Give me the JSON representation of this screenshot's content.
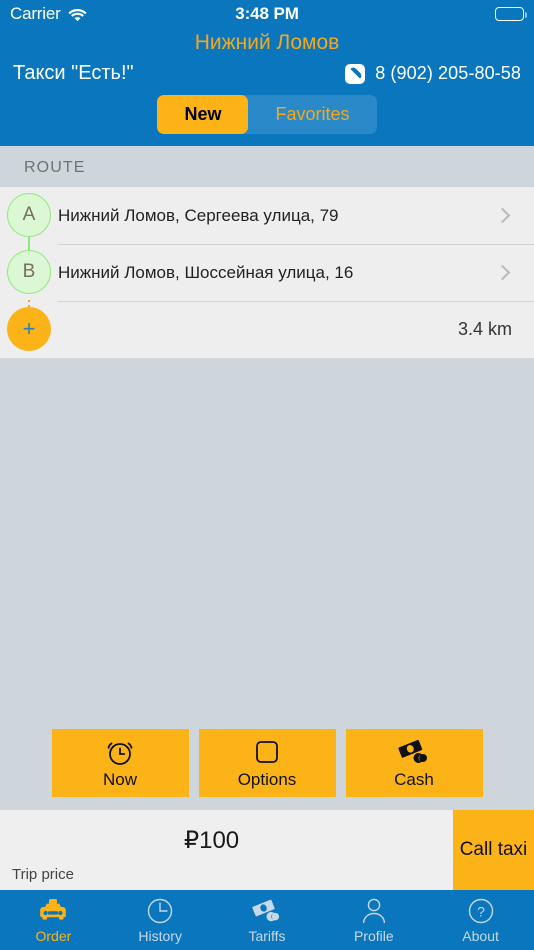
{
  "status_bar": {
    "carrier": "Carrier",
    "wifi_icon": "wifi-icon",
    "time": "3:48 PM",
    "battery_icon": "battery-icon"
  },
  "header": {
    "city": "Нижний Ломов",
    "brand": "Такси \"Есть!\"",
    "phone_icon": "phone-icon",
    "phone": "8 (902) 205-80-58",
    "segments": [
      {
        "label": "New",
        "active": true
      },
      {
        "label": "Favorites",
        "active": false
      }
    ]
  },
  "route": {
    "section_title": "ROUTE",
    "points": [
      {
        "marker": "A",
        "address": "Нижний Ломов, Сергеева улица, 79",
        "chevron_icon": "chevron-right-icon"
      },
      {
        "marker": "B",
        "address": "Нижний Ломов, Шоссейная улица, 16",
        "chevron_icon": "chevron-right-icon"
      }
    ],
    "add_marker": "+",
    "distance": "3.4 km"
  },
  "actions": [
    {
      "label": "Now",
      "icon": "alarm-clock-icon"
    },
    {
      "label": "Options",
      "icon": "square-outline-icon"
    },
    {
      "label": "Cash",
      "icon": "banknote-coins-icon"
    }
  ],
  "price_bar": {
    "price": "₽100",
    "label": "Trip price",
    "call_button": "Call taxi"
  },
  "tabs": [
    {
      "label": "Order",
      "icon": "taxi-icon",
      "active": true
    },
    {
      "label": "History",
      "icon": "clock-icon",
      "active": false
    },
    {
      "label": "Tariffs",
      "icon": "banknote-coins-icon",
      "active": false
    },
    {
      "label": "Profile",
      "icon": "person-icon",
      "active": false
    },
    {
      "label": "About",
      "icon": "question-circle-icon",
      "active": false
    }
  ],
  "colors": {
    "header_blue": "#0a76bd",
    "accent_orange": "#fcb318",
    "title_orange": "#f5a81c",
    "map_gray": "#ced5db",
    "list_gray": "#eeeeee",
    "marker_green": "#dcf7d4"
  }
}
